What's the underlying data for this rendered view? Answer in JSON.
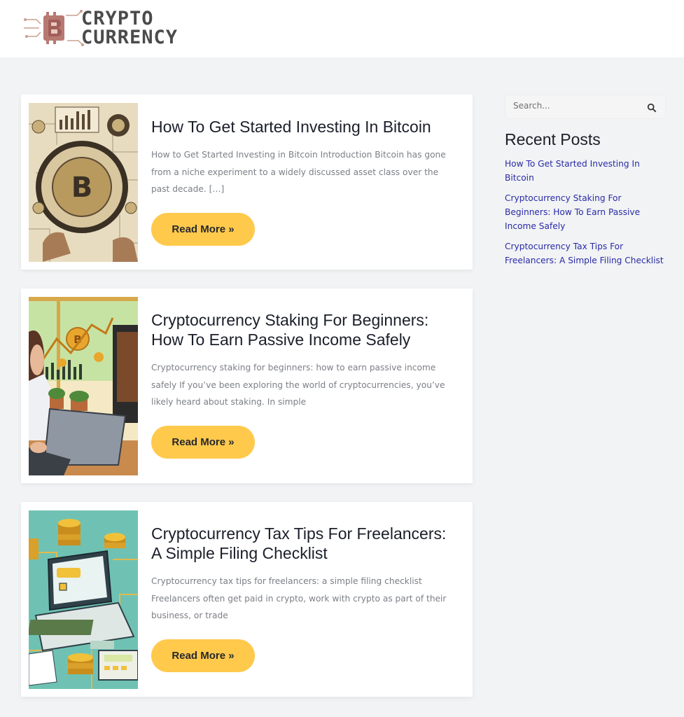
{
  "header": {
    "logo": {
      "line1": "CRYPTO",
      "line2": "CURRENCY",
      "icon": "bitcoin-circuit-logo-icon"
    }
  },
  "posts": [
    {
      "title": "How To Get Started Investing In Bitcoin",
      "excerpt": "How to Get Started Investing in Bitcoin Introduction Bitcoin has gone from a niche experiment to a widely discussed asset class over the past decade. […]",
      "button": "Read More »",
      "thumbnail": "bitcoin-magnifier-illustration"
    },
    {
      "title": "Cryptocurrency Staking For Beginners: How To Earn Passive Income Safely",
      "excerpt": "Cryptocurrency staking for beginners: how to earn passive income safely If you’ve been exploring the world of cryptocurrencies, you’ve likely heard about staking. In simple",
      "button": "Read More »",
      "thumbnail": "woman-laptop-crypto-chart-illustration"
    },
    {
      "title": "Cryptocurrency Tax Tips For Freelancers: A Simple Filing Checklist",
      "excerpt": "Cryptocurrency tax tips for freelancers: a simple filing checklist Freelancers often get paid in crypto, work with crypto as part of their business, or trade",
      "button": "Read More »",
      "thumbnail": "laptop-coins-calculator-illustration"
    }
  ],
  "sidebar": {
    "search": {
      "placeholder": "Search...",
      "icon": "search-icon"
    },
    "recent_title": "Recent Posts",
    "recent_posts": [
      "How To Get Started Investing In Bitcoin",
      "Cryptocurrency Staking For Beginners: How To Earn Passive Income Safely",
      "Cryptocurrency Tax Tips For Freelancers: A Simple Filing Checklist"
    ]
  },
  "colors": {
    "button": "#ffc94c",
    "link": "#2a2aa6",
    "background": "#f1f3f4"
  }
}
